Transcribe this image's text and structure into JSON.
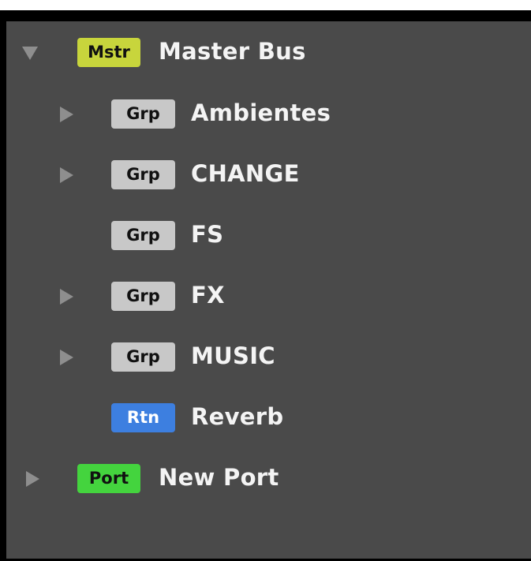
{
  "tree": {
    "master": {
      "badge": "Mstr",
      "label": "Master Bus",
      "badge_color": "#c8d53c",
      "expanded": true
    },
    "children": [
      {
        "badge": "Grp",
        "label": "Ambientes",
        "has_children": true
      },
      {
        "badge": "Grp",
        "label": "CHANGE",
        "has_children": true
      },
      {
        "badge": "Grp",
        "label": "FS",
        "has_children": false
      },
      {
        "badge": "Grp",
        "label": "FX",
        "has_children": true
      },
      {
        "badge": "Grp",
        "label": "MUSIC",
        "has_children": true
      },
      {
        "badge": "Rtn",
        "label": "Reverb",
        "has_children": false
      }
    ],
    "port": {
      "badge": "Port",
      "label": "New Port",
      "badge_color": "#44d43e",
      "expanded": false
    }
  },
  "colors": {
    "panel_bg": "#4a4a4a",
    "grp_badge": "#c8c8c8",
    "rtn_badge": "#3d7fe0",
    "text": "#f4f4f4",
    "arrow": "#8e8e8e"
  }
}
